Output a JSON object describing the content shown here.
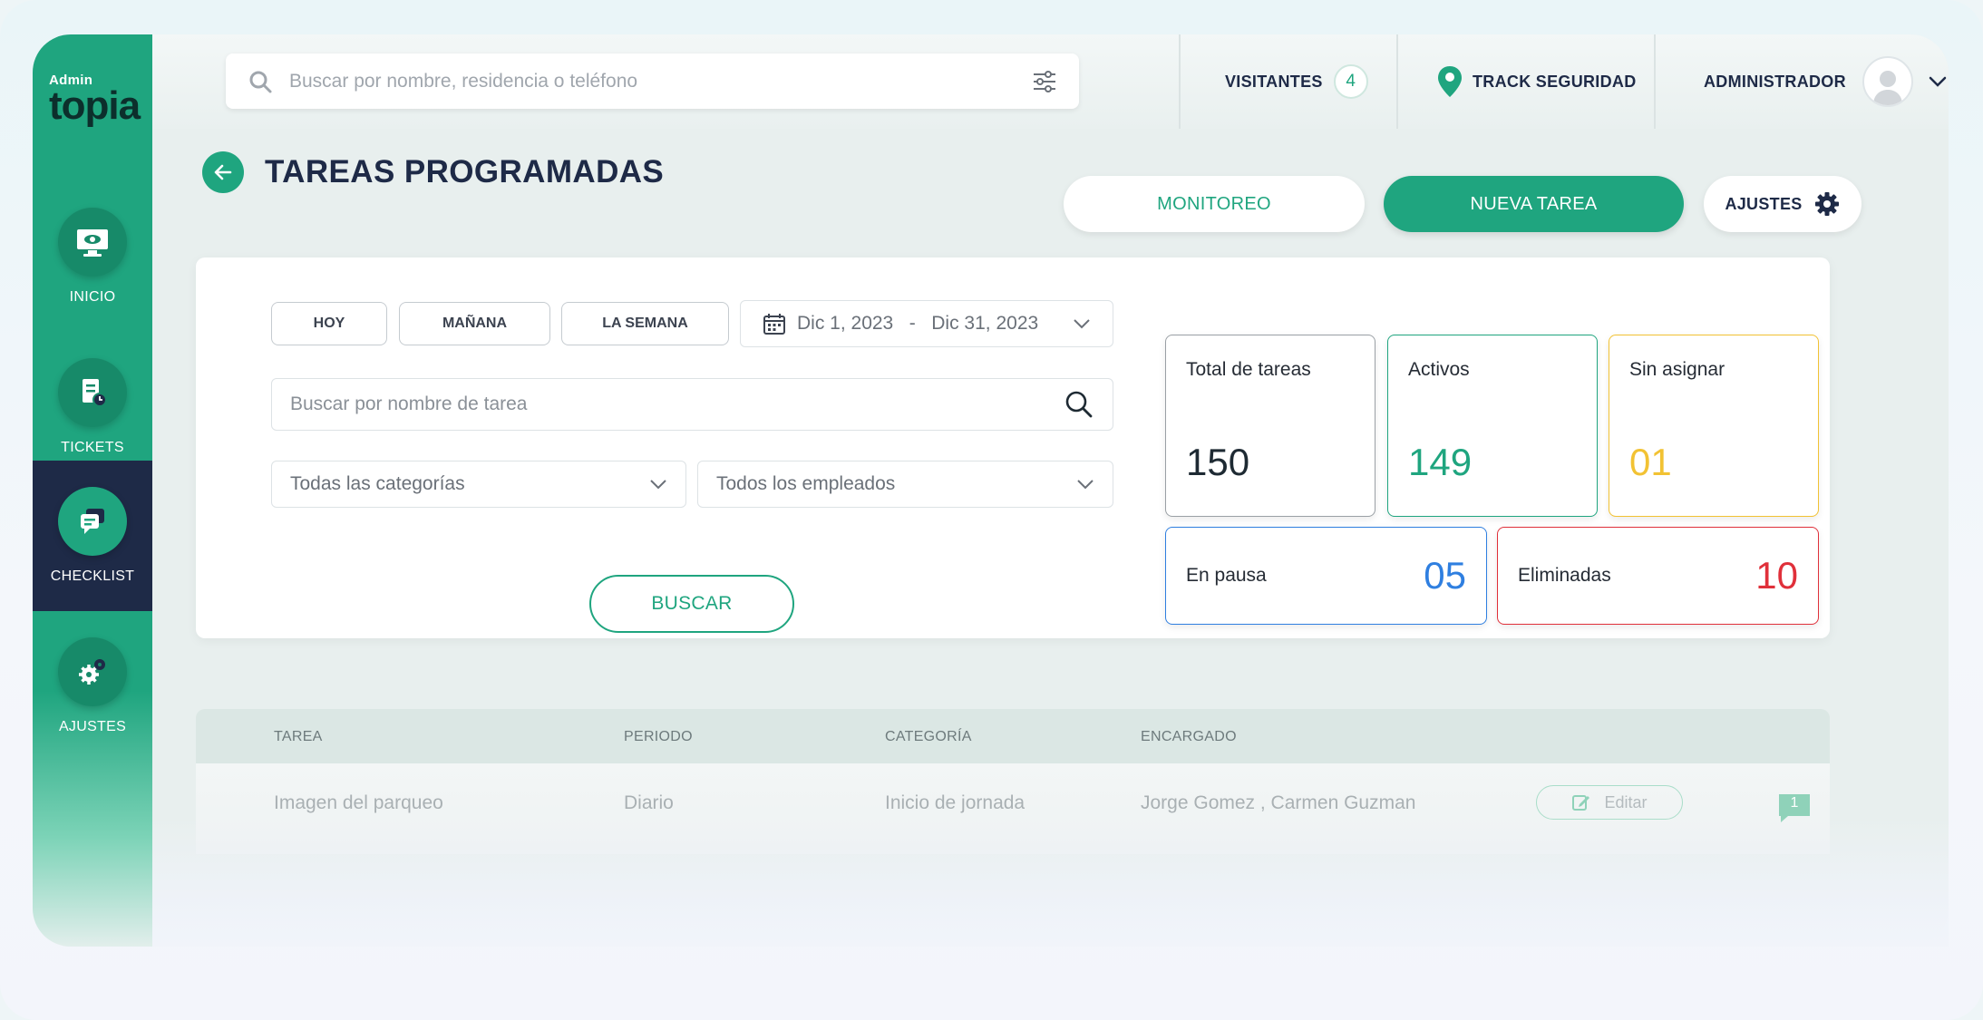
{
  "brand": {
    "small": "Admin",
    "big": "topia"
  },
  "sidebar": {
    "items": [
      {
        "label": "INICIO",
        "icon": "monitor-eye-icon",
        "active": false
      },
      {
        "label": "TICKETS",
        "icon": "ticket-clock-icon",
        "active": false
      },
      {
        "label": "CHECKLIST",
        "icon": "chat-bubbles-icon",
        "active": true
      },
      {
        "label": "AJUSTES",
        "icon": "gears-icon",
        "active": false
      }
    ]
  },
  "topbar": {
    "search_placeholder": "Buscar por nombre, residencia o teléfono",
    "visitantes_label": "VISITANTES",
    "visitantes_count": "4",
    "track_label": "TRACK SEGURIDAD",
    "user_label": "ADMINISTRADOR"
  },
  "header": {
    "title": "TAREAS PROGRAMADAS",
    "monitoreo_label": "MONITOREO",
    "nueva_tarea_label": "NUEVA TAREA",
    "ajustes_label": "AJUSTES"
  },
  "filters": {
    "quick": [
      "HOY",
      "MAÑANA",
      "LA SEMANA"
    ],
    "date_from": "Dic 1, 2023",
    "date_sep": "-",
    "date_to": "Dic 31, 2023",
    "task_search_placeholder": "Buscar por nombre de tarea",
    "category_value": "Todas las categorías",
    "employee_value": "Todos los empleados",
    "buscar_label": "BUSCAR"
  },
  "stats": {
    "total": {
      "label": "Total de tareas",
      "value": "150",
      "color": "#1e2a33"
    },
    "activos": {
      "label": "Activos",
      "value": "149",
      "color": "#1fa57f"
    },
    "sin_asignar": {
      "label": "Sin asignar",
      "value": "01",
      "color": "#f2c233"
    },
    "en_pausa": {
      "label": "En pausa",
      "value": "05",
      "color": "#2f7fe0"
    },
    "eliminadas": {
      "label": "Eliminadas",
      "value": "10",
      "color": "#e0303a"
    }
  },
  "table": {
    "headers": [
      "TAREA",
      "PERIODO",
      "CATEGORÍA",
      "ENCARGADO"
    ],
    "rows": [
      {
        "tarea": "Imagen del parqueo",
        "periodo": "Diario",
        "categoria": "Inicio de jornada",
        "encargado": "Jorge Gomez , Carmen Guzman",
        "edit_label": "Editar",
        "comments": "1"
      }
    ]
  },
  "colors": {
    "accent": "#1fa57f",
    "dark": "#1e2a47"
  }
}
